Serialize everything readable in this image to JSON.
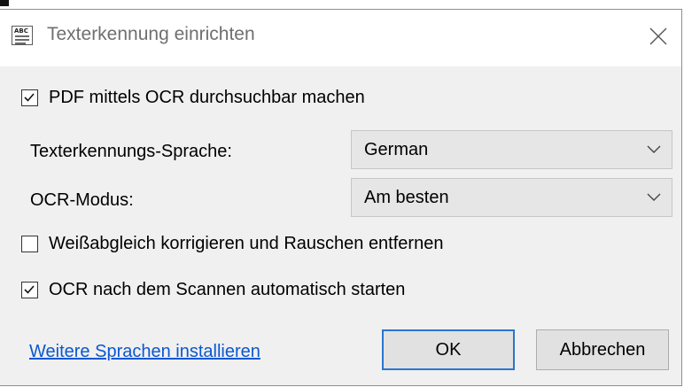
{
  "window": {
    "title": "Texterkennung einrichten",
    "icon": "ocr-abc-icon",
    "close_icon": "close-icon"
  },
  "options": {
    "make_searchable": {
      "label": "PDF mittels OCR durchsuchbar machen",
      "checked": true
    },
    "language": {
      "label": "Texterkennungs-Sprache:",
      "selected": "German"
    },
    "ocr_mode": {
      "label": "OCR-Modus:",
      "selected": "Am besten"
    },
    "white_balance": {
      "label": "Weißabgleich korrigieren und Rauschen entfernen",
      "checked": false
    },
    "auto_start": {
      "label": "OCR nach dem Scannen automatisch starten",
      "checked": true
    }
  },
  "footer": {
    "install_link": "Weitere Sprachen installieren",
    "ok_label": "OK",
    "cancel_label": "Abbrechen"
  },
  "colors": {
    "accent": "#2a75cf",
    "link": "#0a57d1",
    "dialog_bg": "#f0f0f0",
    "title_text": "#6f6f6f"
  }
}
